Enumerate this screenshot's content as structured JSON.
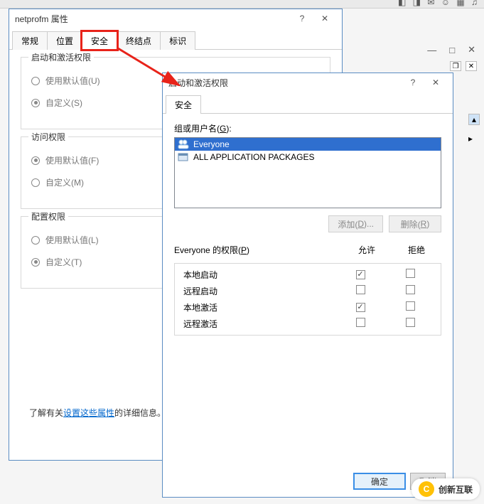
{
  "window1": {
    "title": "netprofm 属性",
    "help": "?",
    "close": "✕",
    "tabs": [
      "常规",
      "位置",
      "安全",
      "终结点",
      "标识"
    ],
    "group1": {
      "title": "启动和激活权限",
      "opt1": "使用默认值(U)",
      "opt2": "自定义(S)"
    },
    "group2": {
      "title": "访问权限",
      "opt1": "使用默认值(F)",
      "opt2": "自定义(M)"
    },
    "group3": {
      "title": "配置权限",
      "opt1": "使用默认值(L)",
      "opt2": "自定义(T)"
    },
    "learn_prefix": "了解有关",
    "learn_link": "设置这些属性",
    "learn_suffix": "的详细信息。"
  },
  "window2": {
    "title": "启动和激活权限",
    "help": "?",
    "close": "✕",
    "tab": "安全",
    "groups_label_pre": "组或用户名(",
    "groups_label_key": "G",
    "groups_label_post": "):",
    "users": [
      {
        "name": "Everyone",
        "selected": true,
        "icon": "group"
      },
      {
        "name": "ALL APPLICATION PACKAGES",
        "selected": false,
        "icon": "package"
      }
    ],
    "btn_add_pre": "添加(",
    "btn_add_key": "D",
    "btn_add_post": ")...",
    "btn_remove_pre": "删除(",
    "btn_remove_key": "R",
    "btn_remove_post": ")",
    "perm_label_pre": "Everyone 的权限(",
    "perm_label_key": "P",
    "perm_label_post": ")",
    "col_allow": "允许",
    "col_deny": "拒绝",
    "perms": [
      {
        "name": "本地启动",
        "allow": true,
        "deny": false
      },
      {
        "name": "远程启动",
        "allow": false,
        "deny": false
      },
      {
        "name": "本地激活",
        "allow": true,
        "deny": false
      },
      {
        "name": "远程激活",
        "allow": false,
        "deny": false
      }
    ],
    "ok": "确定",
    "cancel": "取消"
  },
  "brand": "创新互联"
}
